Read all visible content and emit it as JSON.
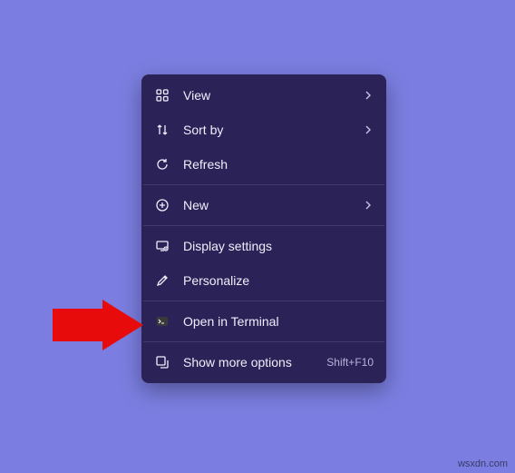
{
  "menu": {
    "view_label": "View",
    "sortby_label": "Sort by",
    "refresh_label": "Refresh",
    "new_label": "New",
    "display_label": "Display settings",
    "personalize_label": "Personalize",
    "terminal_label": "Open in Terminal",
    "showmore_label": "Show more options",
    "showmore_shortcut": "Shift+F10"
  },
  "watermark": "wsxdn.com",
  "colors": {
    "background": "#7b7ee0",
    "menu_bg": "#2b2258",
    "text": "#f0eefa",
    "arrow": "#e80b0b"
  }
}
